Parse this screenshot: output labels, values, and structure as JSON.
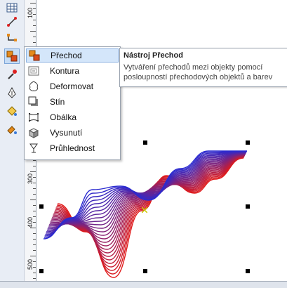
{
  "ruler": {
    "labels": [
      "100",
      "200",
      "300",
      "400",
      "500"
    ]
  },
  "flyout": {
    "items": [
      {
        "label": "Přechod",
        "icon": "blend-icon"
      },
      {
        "label": "Kontura",
        "icon": "contour-icon"
      },
      {
        "label": "Deformovat",
        "icon": "distort-icon"
      },
      {
        "label": "Stín",
        "icon": "shadow-icon"
      },
      {
        "label": "Obálka",
        "icon": "envelope-icon"
      },
      {
        "label": "Vysunutí",
        "icon": "extrude-icon"
      },
      {
        "label": "Průhlednost",
        "icon": "transparency-icon"
      }
    ],
    "hovered": "Přechod"
  },
  "tooltip": {
    "title": "Nástroj Přechod",
    "description": "Vytváření přechodů mezi objekty pomocí posloupností přechodových objektů a barev"
  },
  "colors": {
    "blend_start": "#e01b1b",
    "blend_end": "#2a2ad0",
    "accent": "#c6dcf5"
  }
}
